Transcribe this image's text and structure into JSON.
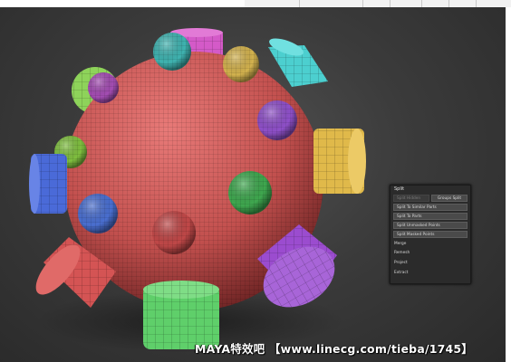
{
  "split_panel": {
    "title": "Split",
    "split_hidden": "Split Hidden",
    "groups_split": "Groups Split",
    "split_to_similar_parts": "Split To Similar Parts",
    "split_to_parts": "Split To Parts",
    "split_unmasked_points": "Split Unmasked Points",
    "split_masked_points": "Split Masked Points",
    "merge": "Merge",
    "remesh": "Remesh",
    "project": "Project",
    "extract": "Extract"
  },
  "watermark": {
    "text": "MAYA特效吧 【www.linecg.com/tieba/1745】"
  },
  "colors": {
    "body_sphere": "#c85a5a",
    "viewport_bg": "#3b3b3b",
    "panel_bg": "#2b2b2b"
  }
}
